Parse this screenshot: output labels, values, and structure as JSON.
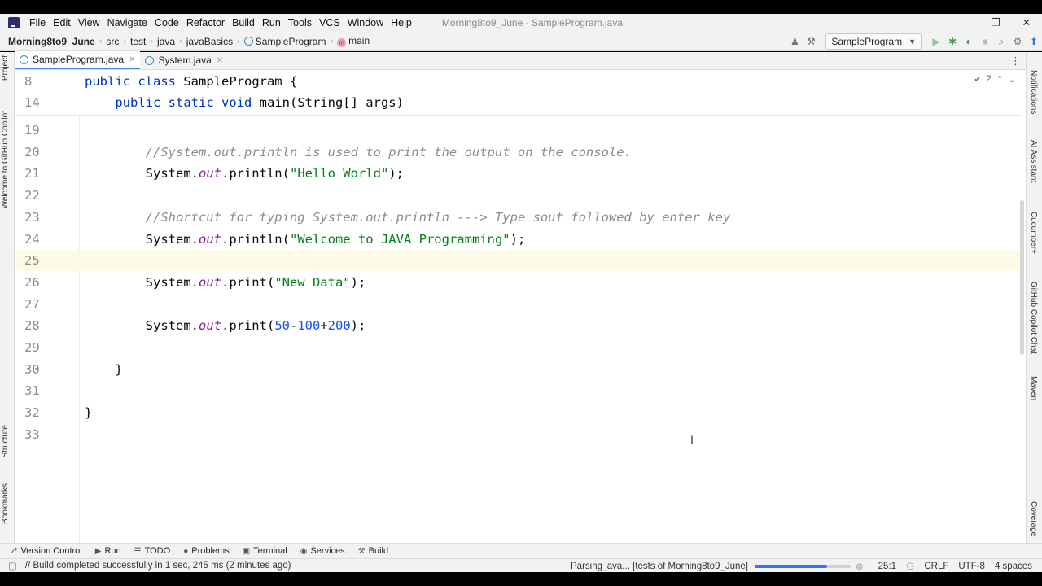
{
  "window": {
    "menu": [
      "File",
      "Edit",
      "View",
      "Navigate",
      "Code",
      "Refactor",
      "Build",
      "Run",
      "Tools",
      "VCS",
      "Window",
      "Help"
    ],
    "title": "Morning8to9_June - SampleProgram.java",
    "controls": [
      "—",
      "❐",
      "✕"
    ]
  },
  "breadcrumb": {
    "project": "Morning8to9_June",
    "parts": [
      "src",
      "test",
      "java",
      "javaBasics"
    ],
    "class": "SampleProgram",
    "method": "main",
    "method_icon": "m"
  },
  "run_config": "SampleProgram",
  "tabs": [
    {
      "label": "SampleProgram.java",
      "active": true
    },
    {
      "label": "System.java",
      "active": false
    }
  ],
  "left_tools": [
    "Project",
    "Welcome to GitHub Copilot",
    "Structure",
    "Bookmarks"
  ],
  "right_tools": [
    "Notifications",
    "AI Assistant",
    "Cucumber+",
    "GitHub Copilot Chat",
    "Maven",
    "Coverage"
  ],
  "inspections": {
    "count": "2"
  },
  "editor": {
    "sticky": [
      {
        "ln": "8",
        "tokens": [
          [
            "kw",
            "public "
          ],
          [
            "kw",
            "class "
          ],
          [
            "",
            "SampleProgram {"
          ]
        ]
      },
      {
        "ln": "14",
        "tokens": [
          [
            "",
            "    "
          ],
          [
            "kw",
            "public "
          ],
          [
            "kw",
            "static "
          ],
          [
            "kw",
            "void "
          ],
          [
            "",
            "main(String[] args)"
          ]
        ]
      }
    ],
    "lines": [
      {
        "ln": "19",
        "tokens": []
      },
      {
        "ln": "20",
        "tokens": [
          [
            "",
            "        "
          ],
          [
            "cm",
            "//System.out.println is used to print the output on the console."
          ]
        ]
      },
      {
        "ln": "21",
        "tokens": [
          [
            "",
            "        System."
          ],
          [
            "fld",
            "out"
          ],
          [
            "",
            ".println("
          ],
          [
            "str",
            "\"Hello World\""
          ],
          [
            "",
            ");"
          ]
        ]
      },
      {
        "ln": "22",
        "tokens": []
      },
      {
        "ln": "23",
        "tokens": [
          [
            "",
            "        "
          ],
          [
            "cm",
            "//Shortcut for typing System.out.println ---> Type sout followed by enter key"
          ]
        ]
      },
      {
        "ln": "24",
        "tokens": [
          [
            "",
            "        System."
          ],
          [
            "fld",
            "out"
          ],
          [
            "",
            ".println("
          ],
          [
            "str",
            "\"Welcome to JAVA Programming\""
          ],
          [
            "",
            ");"
          ]
        ]
      },
      {
        "ln": "25",
        "tokens": []
      },
      {
        "ln": "26",
        "tokens": [
          [
            "",
            "        System."
          ],
          [
            "fld",
            "out"
          ],
          [
            "",
            ".print("
          ],
          [
            "str",
            "\"New Data\""
          ],
          [
            "",
            ");"
          ]
        ]
      },
      {
        "ln": "27",
        "tokens": []
      },
      {
        "ln": "28",
        "tokens": [
          [
            "",
            "        System."
          ],
          [
            "fld",
            "out"
          ],
          [
            "",
            ".print("
          ],
          [
            "num",
            "50"
          ],
          [
            "",
            "-"
          ],
          [
            "num",
            "100"
          ],
          [
            "",
            "+"
          ],
          [
            "num",
            "200"
          ],
          [
            "",
            ");"
          ]
        ]
      },
      {
        "ln": "29",
        "tokens": []
      },
      {
        "ln": "30",
        "tokens": [
          [
            "",
            "    }"
          ]
        ]
      },
      {
        "ln": "31",
        "tokens": []
      },
      {
        "ln": "32",
        "tokens": [
          [
            "",
            "}"
          ]
        ]
      },
      {
        "ln": "33",
        "tokens": []
      }
    ]
  },
  "bottom_tools": [
    {
      "icon": "⎇",
      "label": "Version Control"
    },
    {
      "icon": "▶",
      "label": "Run"
    },
    {
      "icon": "☰",
      "label": "TODO"
    },
    {
      "icon": "●",
      "label": "Problems"
    },
    {
      "icon": "▣",
      "label": "Terminal"
    },
    {
      "icon": "◉",
      "label": "Services"
    },
    {
      "icon": "⚒",
      "label": "Build"
    }
  ],
  "status": {
    "message": "// Build completed successfully in 1 sec, 245 ms (2 minutes ago)",
    "task": "Parsing java... [tests of Morning8to9_June]",
    "progress": 0.75,
    "position": "25:1",
    "line_sep": "CRLF",
    "encoding": "UTF-8",
    "indent": "4 spaces"
  }
}
